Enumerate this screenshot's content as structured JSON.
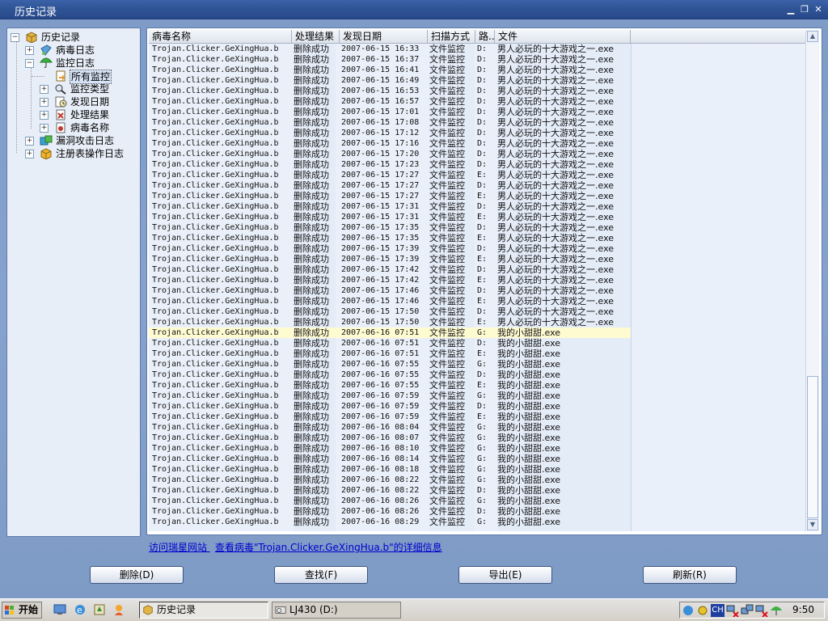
{
  "window": {
    "title": "历史记录"
  },
  "tree": {
    "root": "历史记录",
    "virus_log": "病毒日志",
    "monitor_log": "监控日志",
    "all_monitor": "所有监控",
    "monitor_type": "监控类型",
    "found_date": "发现日期",
    "process_result": "处理结果",
    "virus_name": "病毒名称",
    "vuln_log": "漏洞攻击日志",
    "registry_log": "注册表操作日志"
  },
  "columns": [
    "病毒名称",
    "处理结果",
    "发现日期",
    "扫描方式",
    "路...",
    "文件"
  ],
  "rows": [
    [
      "Trojan.Clicker.GeXingHua.b",
      "删除成功",
      "2007-06-15 16:33",
      "文件监控",
      "D:",
      "男人必玩的十大游戏之一.exe"
    ],
    [
      "Trojan.Clicker.GeXingHua.b",
      "删除成功",
      "2007-06-15 16:37",
      "文件监控",
      "D:",
      "男人必玩的十大游戏之一.exe"
    ],
    [
      "Trojan.Clicker.GeXingHua.b",
      "删除成功",
      "2007-06-15 16:41",
      "文件监控",
      "D:",
      "男人必玩的十大游戏之一.exe"
    ],
    [
      "Trojan.Clicker.GeXingHua.b",
      "删除成功",
      "2007-06-15 16:49",
      "文件监控",
      "D:",
      "男人必玩的十大游戏之一.exe"
    ],
    [
      "Trojan.Clicker.GeXingHua.b",
      "删除成功",
      "2007-06-15 16:53",
      "文件监控",
      "D:",
      "男人必玩的十大游戏之一.exe"
    ],
    [
      "Trojan.Clicker.GeXingHua.b",
      "删除成功",
      "2007-06-15 16:57",
      "文件监控",
      "D:",
      "男人必玩的十大游戏之一.exe"
    ],
    [
      "Trojan.Clicker.GeXingHua.b",
      "删除成功",
      "2007-06-15 17:01",
      "文件监控",
      "D:",
      "男人必玩的十大游戏之一.exe"
    ],
    [
      "Trojan.Clicker.GeXingHua.b",
      "删除成功",
      "2007-06-15 17:08",
      "文件监控",
      "D:",
      "男人必玩的十大游戏之一.exe"
    ],
    [
      "Trojan.Clicker.GeXingHua.b",
      "删除成功",
      "2007-06-15 17:12",
      "文件监控",
      "D:",
      "男人必玩的十大游戏之一.exe"
    ],
    [
      "Trojan.Clicker.GeXingHua.b",
      "删除成功",
      "2007-06-15 17:16",
      "文件监控",
      "D:",
      "男人必玩的十大游戏之一.exe"
    ],
    [
      "Trojan.Clicker.GeXingHua.b",
      "删除成功",
      "2007-06-15 17:20",
      "文件监控",
      "D:",
      "男人必玩的十大游戏之一.exe"
    ],
    [
      "Trojan.Clicker.GeXingHua.b",
      "删除成功",
      "2007-06-15 17:23",
      "文件监控",
      "D:",
      "男人必玩的十大游戏之一.exe"
    ],
    [
      "Trojan.Clicker.GeXingHua.b",
      "删除成功",
      "2007-06-15 17:27",
      "文件监控",
      "E:",
      "男人必玩的十大游戏之一.exe"
    ],
    [
      "Trojan.Clicker.GeXingHua.b",
      "删除成功",
      "2007-06-15 17:27",
      "文件监控",
      "D:",
      "男人必玩的十大游戏之一.exe"
    ],
    [
      "Trojan.Clicker.GeXingHua.b",
      "删除成功",
      "2007-06-15 17:27",
      "文件监控",
      "E:",
      "男人必玩的十大游戏之一.exe"
    ],
    [
      "Trojan.Clicker.GeXingHua.b",
      "删除成功",
      "2007-06-15 17:31",
      "文件监控",
      "D:",
      "男人必玩的十大游戏之一.exe"
    ],
    [
      "Trojan.Clicker.GeXingHua.b",
      "删除成功",
      "2007-06-15 17:31",
      "文件监控",
      "E:",
      "男人必玩的十大游戏之一.exe"
    ],
    [
      "Trojan.Clicker.GeXingHua.b",
      "删除成功",
      "2007-06-15 17:35",
      "文件监控",
      "D:",
      "男人必玩的十大游戏之一.exe"
    ],
    [
      "Trojan.Clicker.GeXingHua.b",
      "删除成功",
      "2007-06-15 17:35",
      "文件监控",
      "E:",
      "男人必玩的十大游戏之一.exe"
    ],
    [
      "Trojan.Clicker.GeXingHua.b",
      "删除成功",
      "2007-06-15 17:39",
      "文件监控",
      "D:",
      "男人必玩的十大游戏之一.exe"
    ],
    [
      "Trojan.Clicker.GeXingHua.b",
      "删除成功",
      "2007-06-15 17:39",
      "文件监控",
      "E:",
      "男人必玩的十大游戏之一.exe"
    ],
    [
      "Trojan.Clicker.GeXingHua.b",
      "删除成功",
      "2007-06-15 17:42",
      "文件监控",
      "D:",
      "男人必玩的十大游戏之一.exe"
    ],
    [
      "Trojan.Clicker.GeXingHua.b",
      "删除成功",
      "2007-06-15 17:42",
      "文件监控",
      "E:",
      "男人必玩的十大游戏之一.exe"
    ],
    [
      "Trojan.Clicker.GeXingHua.b",
      "删除成功",
      "2007-06-15 17:46",
      "文件监控",
      "D:",
      "男人必玩的十大游戏之一.exe"
    ],
    [
      "Trojan.Clicker.GeXingHua.b",
      "删除成功",
      "2007-06-15 17:46",
      "文件监控",
      "E:",
      "男人必玩的十大游戏之一.exe"
    ],
    [
      "Trojan.Clicker.GeXingHua.b",
      "删除成功",
      "2007-06-15 17:50",
      "文件监控",
      "D:",
      "男人必玩的十大游戏之一.exe"
    ],
    [
      "Trojan.Clicker.GeXingHua.b",
      "删除成功",
      "2007-06-15 17:50",
      "文件监控",
      "E:",
      "男人必玩的十大游戏之一.exe"
    ],
    [
      "Trojan.Clicker.GeXingHua.b",
      "删除成功",
      "2007-06-16 07:51",
      "文件监控",
      "G:",
      "我的小甜甜.exe"
    ],
    [
      "Trojan.Clicker.GeXingHua.b",
      "删除成功",
      "2007-06-16 07:51",
      "文件监控",
      "D:",
      "我的小甜甜.exe"
    ],
    [
      "Trojan.Clicker.GeXingHua.b",
      "删除成功",
      "2007-06-16 07:51",
      "文件监控",
      "E:",
      "我的小甜甜.exe"
    ],
    [
      "Trojan.Clicker.GeXingHua.b",
      "删除成功",
      "2007-06-16 07:55",
      "文件监控",
      "G:",
      "我的小甜甜.exe"
    ],
    [
      "Trojan.Clicker.GeXingHua.b",
      "删除成功",
      "2007-06-16 07:55",
      "文件监控",
      "D:",
      "我的小甜甜.exe"
    ],
    [
      "Trojan.Clicker.GeXingHua.b",
      "删除成功",
      "2007-06-16 07:55",
      "文件监控",
      "E:",
      "我的小甜甜.exe"
    ],
    [
      "Trojan.Clicker.GeXingHua.b",
      "删除成功",
      "2007-06-16 07:59",
      "文件监控",
      "G:",
      "我的小甜甜.exe"
    ],
    [
      "Trojan.Clicker.GeXingHua.b",
      "删除成功",
      "2007-06-16 07:59",
      "文件监控",
      "D:",
      "我的小甜甜.exe"
    ],
    [
      "Trojan.Clicker.GeXingHua.b",
      "删除成功",
      "2007-06-16 07:59",
      "文件监控",
      "E:",
      "我的小甜甜.exe"
    ],
    [
      "Trojan.Clicker.GeXingHua.b",
      "删除成功",
      "2007-06-16 08:04",
      "文件监控",
      "G:",
      "我的小甜甜.exe"
    ],
    [
      "Trojan.Clicker.GeXingHua.b",
      "删除成功",
      "2007-06-16 08:07",
      "文件监控",
      "G:",
      "我的小甜甜.exe"
    ],
    [
      "Trojan.Clicker.GeXingHua.b",
      "删除成功",
      "2007-06-16 08:10",
      "文件监控",
      "G:",
      "我的小甜甜.exe"
    ],
    [
      "Trojan.Clicker.GeXingHua.b",
      "删除成功",
      "2007-06-16 08:14",
      "文件监控",
      "G:",
      "我的小甜甜.exe"
    ],
    [
      "Trojan.Clicker.GeXingHua.b",
      "删除成功",
      "2007-06-16 08:18",
      "文件监控",
      "G:",
      "我的小甜甜.exe"
    ],
    [
      "Trojan.Clicker.GeXingHua.b",
      "删除成功",
      "2007-06-16 08:22",
      "文件监控",
      "G:",
      "我的小甜甜.exe"
    ],
    [
      "Trojan.Clicker.GeXingHua.b",
      "删除成功",
      "2007-06-16 08:22",
      "文件监控",
      "D:",
      "我的小甜甜.exe"
    ],
    [
      "Trojan.Clicker.GeXingHua.b",
      "删除成功",
      "2007-06-16 08:26",
      "文件监控",
      "G:",
      "我的小甜甜.exe"
    ],
    [
      "Trojan.Clicker.GeXingHua.b",
      "删除成功",
      "2007-06-16 08:26",
      "文件监控",
      "D:",
      "我的小甜甜.exe"
    ],
    [
      "Trojan.Clicker.GeXingHua.b",
      "删除成功",
      "2007-06-16 08:29",
      "文件监控",
      "G:",
      "我的小甜甜.exe"
    ]
  ],
  "selected_row": 27,
  "links": {
    "visit_site": "访问瑞星网站",
    "view_virus": "查看病毒\"Trojan.Clicker.GeXingHua.b\"的详细信息"
  },
  "buttons": {
    "delete": "删除(D)",
    "find": "查找(F)",
    "export": "导出(E)",
    "refresh": "刷新(R)"
  },
  "taskbar": {
    "start": "开始",
    "task_history": "历史记录",
    "task_drive": "LJ430 (D:)",
    "lang": "CH",
    "clock": "9:50"
  },
  "colors": {
    "title_bar": "#2f5496",
    "panel_bg": "#86a2cc",
    "link": "#0000cc",
    "row_highlight": "#fffbd0"
  }
}
